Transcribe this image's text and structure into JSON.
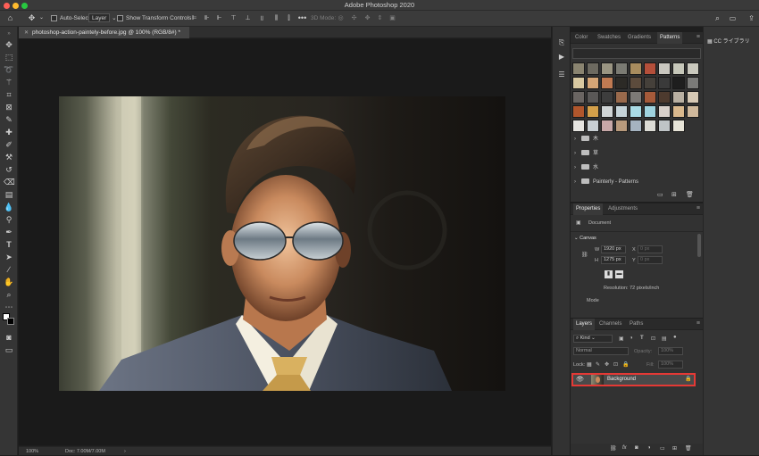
{
  "app": {
    "title": "Adobe Photoshop 2020"
  },
  "options_bar": {
    "auto_select_label": "Auto-Select:",
    "auto_select_value": "Layer",
    "show_transform_label": "Show Transform Controls",
    "mode_3d_label": "3D Mode:"
  },
  "document": {
    "tab_title": "photoshop-action-paintely-before.jpg @ 100% (RGB/8#) *",
    "zoom": "100%",
    "doc_size": "Doc: 7.00M/7.00M"
  },
  "swatches_panel": {
    "tabs": [
      "Color",
      "Swatches",
      "Gradients",
      "Patterns"
    ],
    "active_tab": "Patterns",
    "pattern_colors": [
      "#8a8470",
      "#6d6a60",
      "#9a9582",
      "#7b7b73",
      "#a88c5e",
      "#b44f3a",
      "#c9c7bf",
      "#c6c7b9",
      "#c9c8bd",
      "#d9c9a1",
      "#d6a676",
      "#c07a52",
      "#2c2a26",
      "#5c4b3c",
      "#45403a",
      "#3a3a3a",
      "#1e1e1e",
      "#7a7a78",
      "#6a6562",
      "#5a5857",
      "#3d3d3d",
      "#9a6a4c",
      "#7d7a77",
      "#a55a3a",
      "#4d3a2e",
      "#b9b0a2",
      "#d7c9b5",
      "#b0562c",
      "#d4a04a",
      "#cfd4d5",
      "#c5d3d8",
      "#a9dbe5",
      "#9fd3df",
      "#d8d0ca",
      "#d9b88d",
      "#cfb89b",
      "#e5e4e0",
      "#c8cfd3",
      "#c7a8a8",
      "#b89a7c",
      "#a5b3c0",
      "#dcdcd6",
      "#bfc4c6",
      "#e7e4d8"
    ],
    "folders": [
      {
        "label": "木"
      },
      {
        "label": "草"
      },
      {
        "label": "水"
      },
      {
        "label": "Painterly - Patterns"
      }
    ]
  },
  "properties_panel": {
    "tabs": [
      "Properties",
      "Adjustments"
    ],
    "active_tab": "Properties",
    "document_label": "Document",
    "canvas_label": "Canvas",
    "w_label": "W",
    "w_value": "1920 px",
    "h_label": "H",
    "h_value": "1275 px",
    "x_label": "X",
    "x_placeholder": "0 px",
    "y_label": "Y",
    "y_placeholder": "0 px",
    "resolution": "Resolution: 72 pixels/inch",
    "mode_label": "Mode"
  },
  "layers_panel": {
    "tabs": [
      "Layers",
      "Channels",
      "Paths"
    ],
    "active_tab": "Layers",
    "filter_kind": "Kind",
    "blend_mode": "Normal",
    "opacity_label": "Opacity:",
    "opacity_value": "100%",
    "lock_label": "Lock:",
    "fill_label": "Fill:",
    "fill_value": "100%",
    "layers": [
      {
        "name": "Background",
        "visible": true,
        "locked": true
      }
    ]
  },
  "libraries": {
    "label": "CC ライブラリ"
  },
  "colors": {
    "highlight": "#e53935",
    "panel_bg": "#323232",
    "canvas_bg": "#1a1a1a"
  }
}
